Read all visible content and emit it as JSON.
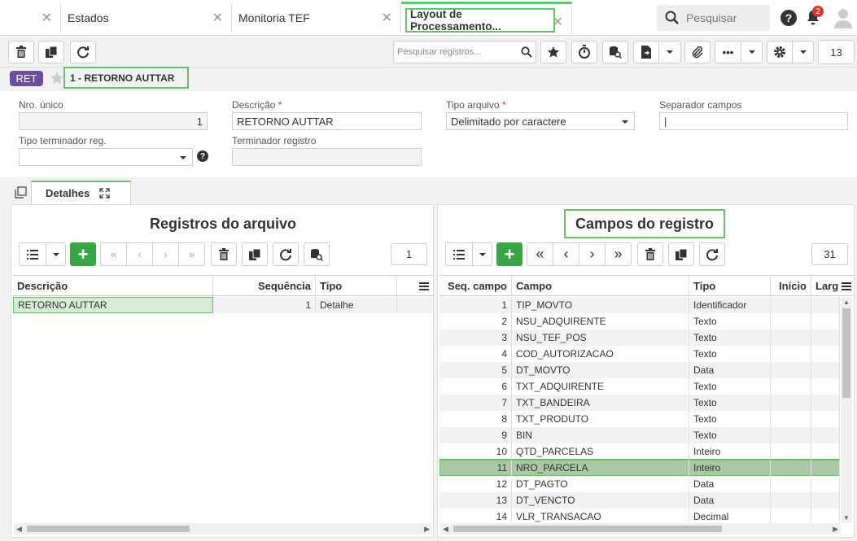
{
  "tabs": [
    {
      "label": "Estados"
    },
    {
      "label": "Monitoria TEF"
    },
    {
      "label": "Layout de Processamento..."
    }
  ],
  "top_search": {
    "placeholder": "Pesquisar"
  },
  "notifications": {
    "count": "2"
  },
  "toolbar": {
    "search_placeholder": "Pesquisar registros...",
    "page_count": "13"
  },
  "record": {
    "badge": "RET",
    "title": "1 - RETORNO AUTTAR"
  },
  "form": {
    "nro_unico": {
      "label": "Nro. único",
      "value": "1"
    },
    "descricao": {
      "label": "Descrição",
      "value": "RETORNO AUTTAR"
    },
    "tipo_arquivo": {
      "label": "Tipo arquivo",
      "value": "Delimitado por caractere"
    },
    "separador": {
      "label": "Separador campos",
      "value": "|"
    },
    "tipo_terminador": {
      "label": "Tipo terminador reg.",
      "value": ""
    },
    "terminador": {
      "label": "Terminador registro",
      "value": ""
    },
    "required_mark": "*"
  },
  "detail_tab": {
    "label": "Detalhes"
  },
  "left_panel": {
    "title": "Registros do arquivo",
    "count": "1",
    "columns": [
      "Descrição",
      "Sequência",
      "Tipo"
    ],
    "rows": [
      [
        "RETORNO AUTTAR",
        "1",
        "Detalhe"
      ]
    ]
  },
  "right_panel": {
    "title": "Campos do registro",
    "count": "31",
    "columns": [
      "Seq. campo",
      "Campo",
      "Tipo",
      "Início",
      "Larg"
    ],
    "rows": [
      [
        "1",
        "TIP_MOVTO",
        "Identificador"
      ],
      [
        "2",
        "NSU_ADQUIRENTE",
        "Texto"
      ],
      [
        "3",
        "NSU_TEF_POS",
        "Texto"
      ],
      [
        "4",
        "COD_AUTORIZACAO",
        "Texto"
      ],
      [
        "5",
        "DT_MOVTO",
        "Data"
      ],
      [
        "6",
        "TXT_ADQUIRENTE",
        "Texto"
      ],
      [
        "7",
        "TXT_BANDEIRA",
        "Texto"
      ],
      [
        "8",
        "TXT_PRODUTO",
        "Texto"
      ],
      [
        "9",
        "BIN",
        "Texto"
      ],
      [
        "10",
        "QTD_PARCELAS",
        "Inteiro"
      ],
      [
        "11",
        "NRO_PARCELA",
        "Inteiro"
      ],
      [
        "12",
        "DT_PAGTO",
        "Data"
      ],
      [
        "13",
        "DT_VENCTO",
        "Data"
      ],
      [
        "14",
        "VLR_TRANSACAO",
        "Decimal"
      ]
    ],
    "selected_row": 10
  },
  "colors": {
    "accent_green": "#3aa547",
    "highlight": "#66c266",
    "badge": "#6d4e9a",
    "selected_row": "#a9c9a4"
  }
}
